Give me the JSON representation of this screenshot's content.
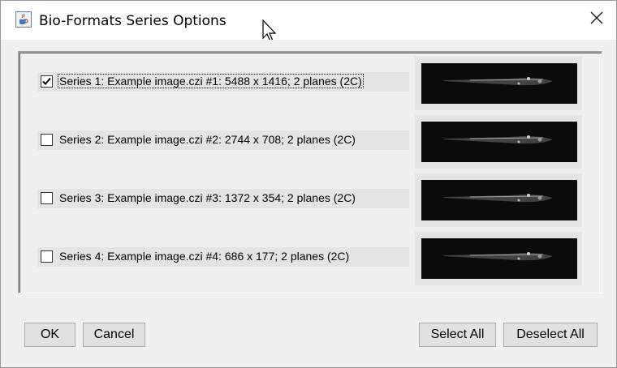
{
  "window": {
    "title": "Bio-Formats Series Options",
    "app_icon": "java-cup-icon",
    "close_icon": "close-icon"
  },
  "series": [
    {
      "label": "Series 1: Example image.czi #1: 5488 x 1416; 2 planes (2C)",
      "checked": true
    },
    {
      "label": "Series 2: Example image.czi #2: 2744 x 708; 2 planes (2C)",
      "checked": false
    },
    {
      "label": "Series 3: Example image.czi #3: 1372 x 354; 2 planes (2C)",
      "checked": false
    },
    {
      "label": "Series 4: Example image.czi #4: 686 x 177; 2 planes (2C)",
      "checked": false
    }
  ],
  "buttons": {
    "ok": "OK",
    "cancel": "Cancel",
    "select_all": "Select All",
    "deselect_all": "Deselect All"
  },
  "colors": {
    "dialog_bg": "#f0f0f0",
    "thumbnail_bg": "#0b0b0b",
    "button_bg": "#e1e1e1"
  }
}
